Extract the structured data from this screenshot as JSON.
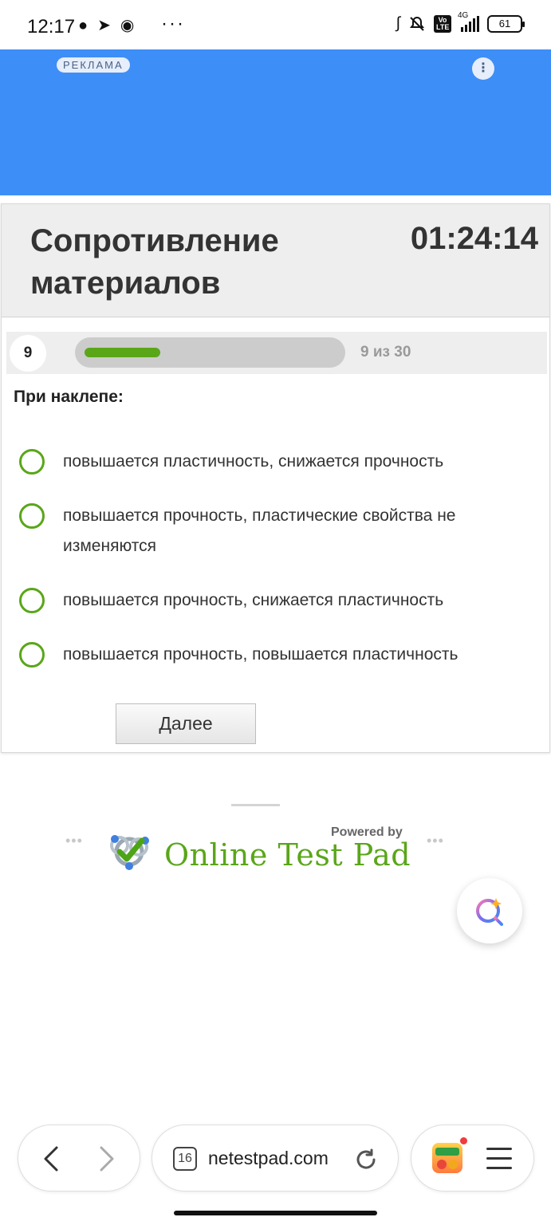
{
  "status_bar": {
    "time": "12:17",
    "battery": "61",
    "network": "4G",
    "volte": "Vo LTE"
  },
  "ad": {
    "badge": "РЕКЛАМА",
    "menu_icon": "kebab-icon",
    "background": "#3e8ef7"
  },
  "test": {
    "title": "Сопротивление материалов",
    "timer": "01:24:14",
    "question_number": "9",
    "progress_text": "9 из 30",
    "progress_fraction": 0.3,
    "question": "При наклепе:",
    "options": [
      "повышается пластичность, снижается прочность",
      "повышается прочность, пластические свойства не изменяются",
      "повышается прочность, снижается пластичность",
      "повышается прочность, повышается пластичность"
    ],
    "next_label": "Далее",
    "accent_color": "#5aa619"
  },
  "branding": {
    "powered_by": "Powered by",
    "name": "Online Test Pad"
  },
  "browser": {
    "tab_count": "16",
    "url": "netestpad.com"
  }
}
